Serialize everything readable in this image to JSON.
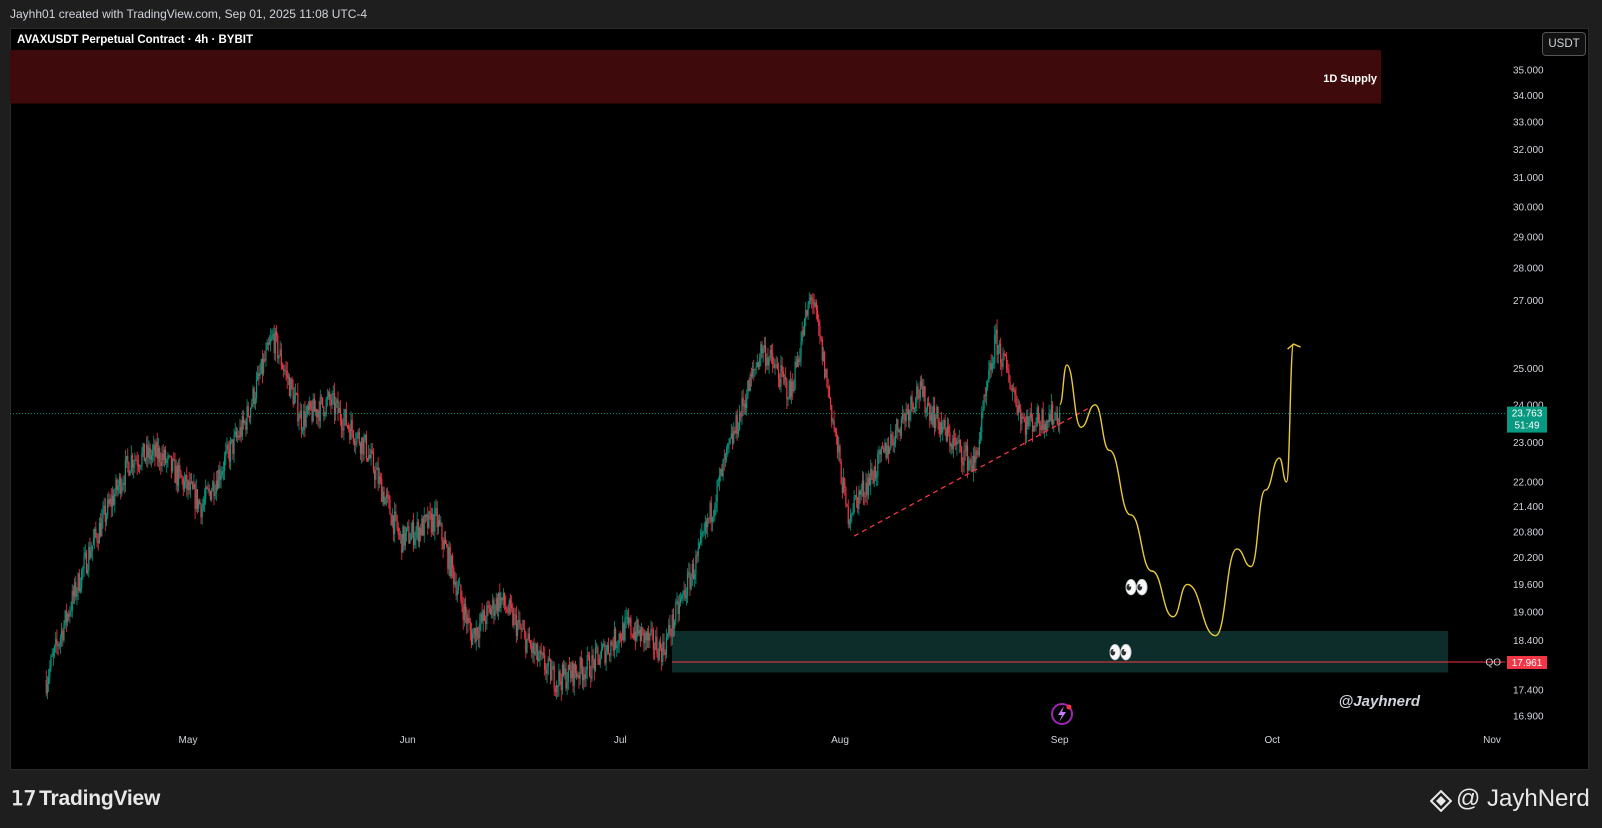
{
  "header": {
    "attribution": "Jayhh01 created with TradingView.com, Sep 01, 2025 11:08 UTC-4"
  },
  "chart_data": {
    "type": "candlestick",
    "title": "AVAXUSDT Perpetual Contract · 4h · BYBIT",
    "currency_button": "USDT",
    "y_axis_ticks": [
      "35.000",
      "34.000",
      "33.000",
      "32.000",
      "31.000",
      "30.000",
      "29.000",
      "28.000",
      "27.000",
      "25.000",
      "24.000",
      "23.000",
      "22.000",
      "21.400",
      "20.800",
      "20.200",
      "19.600",
      "19.000",
      "18.400",
      "17.400",
      "16.900"
    ],
    "y_scale": "log",
    "x_axis_ticks": [
      "May",
      "Jun",
      "Jul",
      "Aug",
      "Sep",
      "Oct",
      "Nov"
    ],
    "current_price": {
      "value": "23.763",
      "countdown": "51:49",
      "color": "#089981"
    },
    "qo_level": {
      "label": "QO",
      "value": "17.961",
      "color": "#f23645"
    },
    "zones": [
      {
        "label": "1D Supply",
        "low": 33.7,
        "high": 35.8,
        "color": "#3f0a0b"
      },
      {
        "label": "",
        "low": 17.75,
        "high": 18.6,
        "color": "#0d2d2a"
      }
    ],
    "price_path": [
      {
        "date": "Apr 11",
        "price": 17.6
      },
      {
        "date": "Apr 17",
        "price": 20.3
      },
      {
        "date": "Apr 23",
        "price": 22.6
      },
      {
        "date": "Apr 27",
        "price": 22.7
      },
      {
        "date": "May 03",
        "price": 21.4
      },
      {
        "date": "May 09",
        "price": 23.5
      },
      {
        "date": "May 13",
        "price": 25.9
      },
      {
        "date": "May 17",
        "price": 23.6
      },
      {
        "date": "May 21",
        "price": 24.1
      },
      {
        "date": "May 26",
        "price": 22.9
      },
      {
        "date": "May 31",
        "price": 20.6
      },
      {
        "date": "Jun 05",
        "price": 21.1
      },
      {
        "date": "Jun 10",
        "price": 18.5
      },
      {
        "date": "Jun 14",
        "price": 19.3
      },
      {
        "date": "Jun 19",
        "price": 18.1
      },
      {
        "date": "Jun 22",
        "price": 17.6
      },
      {
        "date": "Jun 27",
        "price": 17.9
      },
      {
        "date": "Jul 02",
        "price": 18.7
      },
      {
        "date": "Jul 07",
        "price": 18.2
      },
      {
        "date": "Jul 12",
        "price": 20.2
      },
      {
        "date": "Jul 17",
        "price": 23.2
      },
      {
        "date": "Jul 21",
        "price": 25.6
      },
      {
        "date": "Jul 25",
        "price": 24.3
      },
      {
        "date": "Jul 28",
        "price": 27.2
      },
      {
        "date": "Aug 02",
        "price": 21.2
      },
      {
        "date": "Aug 06",
        "price": 22.3
      },
      {
        "date": "Aug 12",
        "price": 24.4
      },
      {
        "date": "Aug 16",
        "price": 23.2
      },
      {
        "date": "Aug 20",
        "price": 22.4
      },
      {
        "date": "Aug 23",
        "price": 25.8
      },
      {
        "date": "Aug 27",
        "price": 23.5
      },
      {
        "date": "Sep 01",
        "price": 23.76
      }
    ],
    "trendline": {
      "from": {
        "date": "Aug 03",
        "price": 20.7
      },
      "to": {
        "date": "Sep 05",
        "price": 23.9
      },
      "style": "dashed",
      "color": "#f23645"
    },
    "projection_path": {
      "color": "#e8c93a",
      "points": [
        {
          "date": "Sep 01",
          "price": 24.0
        },
        {
          "date": "Sep 02",
          "price": 25.1
        },
        {
          "date": "Sep 04",
          "price": 23.4
        },
        {
          "date": "Sep 06",
          "price": 24.0
        },
        {
          "date": "Sep 08",
          "price": 22.8
        },
        {
          "date": "Sep 11",
          "price": 21.2
        },
        {
          "date": "Sep 14",
          "price": 19.9
        },
        {
          "date": "Sep 17",
          "price": 18.9
        },
        {
          "date": "Sep 19",
          "price": 19.6
        },
        {
          "date": "Sep 23",
          "price": 18.5
        },
        {
          "date": "Sep 26",
          "price": 20.4
        },
        {
          "date": "Sep 28",
          "price": 20.0
        },
        {
          "date": "Sep 30",
          "price": 21.8
        },
        {
          "date": "Oct 02",
          "price": 22.6
        },
        {
          "date": "Oct 03",
          "price": 22.0
        },
        {
          "date": "Oct 04",
          "price": 25.7
        }
      ]
    },
    "annotations": [
      {
        "text": "@Jayhnerd",
        "type": "signature"
      },
      {
        "text": "👀",
        "type": "emoji"
      },
      {
        "text": "👀",
        "type": "emoji"
      }
    ]
  },
  "footer": {
    "logo_text": "TradingView",
    "watermark": "@ JayhNerd"
  },
  "icons": {
    "bolt": "lightning-bolt-icon",
    "brand": "tradingview-logo-icon",
    "exchange": "binance-diamond-icon"
  }
}
